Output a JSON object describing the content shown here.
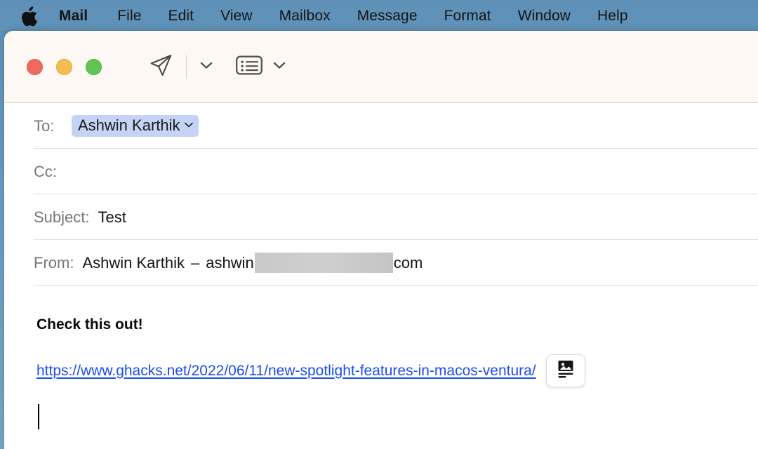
{
  "menubar": {
    "apple_icon": "apple-logo-icon",
    "items": [
      {
        "label": "Mail",
        "bold": true
      },
      {
        "label": "File",
        "bold": false
      },
      {
        "label": "Edit",
        "bold": false
      },
      {
        "label": "View",
        "bold": false
      },
      {
        "label": "Mailbox",
        "bold": false
      },
      {
        "label": "Message",
        "bold": false
      },
      {
        "label": "Format",
        "bold": false
      },
      {
        "label": "Window",
        "bold": false
      },
      {
        "label": "Help",
        "bold": false
      }
    ],
    "gradient_start": "#bfdcc4",
    "gradient_end": "#e4d99b"
  },
  "window": {
    "traffic_lights": {
      "close_color": "#ee6a5f",
      "minimize_color": "#f5bd4f",
      "zoom_color": "#61c554"
    },
    "toolbar": {
      "send_icon": "paper-plane-send-icon",
      "send_options_icon": "chevron-down-icon",
      "header_fields_icon": "header-fields-icon",
      "header_fields_options_icon": "chevron-down-icon",
      "background": "#fdf8f3"
    }
  },
  "compose": {
    "to": {
      "label": "To:",
      "recipients": [
        "Ashwin Karthik"
      ],
      "token_chevron_icon": "chevron-down-icon",
      "token_background": "#c5d3f5"
    },
    "cc": {
      "label": "Cc:",
      "value": ""
    },
    "subject": {
      "label": "Subject:",
      "value": "Test"
    },
    "from": {
      "label": "From:",
      "display_name": "Ashwin Karthik",
      "separator": "–",
      "email_prefix": "ashwin",
      "email_redacted": true,
      "email_suffix": "com"
    },
    "body": {
      "text": "Check this out!",
      "link_text": "https://www.ghacks.net/2022/06/11/new-spotlight-features-in-macos-ventura/",
      "link_color": "#1a4ff0",
      "preview_toggle_icon": "rich-link-preview-icon",
      "caret_visible": true
    }
  }
}
